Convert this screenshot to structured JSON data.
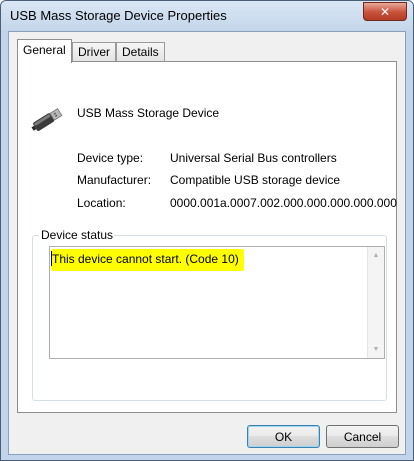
{
  "window": {
    "title": "USB Mass Storage Device Properties",
    "close_glyph": "✕"
  },
  "tabs": [
    {
      "label": "General",
      "active": true
    },
    {
      "label": "Driver",
      "active": false
    },
    {
      "label": "Details",
      "active": false
    }
  ],
  "device": {
    "icon": "usb-device-icon",
    "name": "USB Mass Storage Device",
    "properties": [
      {
        "label": "Device type:",
        "value": "Universal Serial Bus controllers"
      },
      {
        "label": "Manufacturer:",
        "value": "Compatible USB storage device"
      },
      {
        "label": "Location:",
        "value": "0000.001a.0007.002.000.000.000.000.000"
      }
    ]
  },
  "status": {
    "group_label": "Device status",
    "text": "This device cannot start. (Code 10)",
    "highlight_color": "#ffff00"
  },
  "buttons": {
    "ok": "OK",
    "cancel": "Cancel"
  }
}
